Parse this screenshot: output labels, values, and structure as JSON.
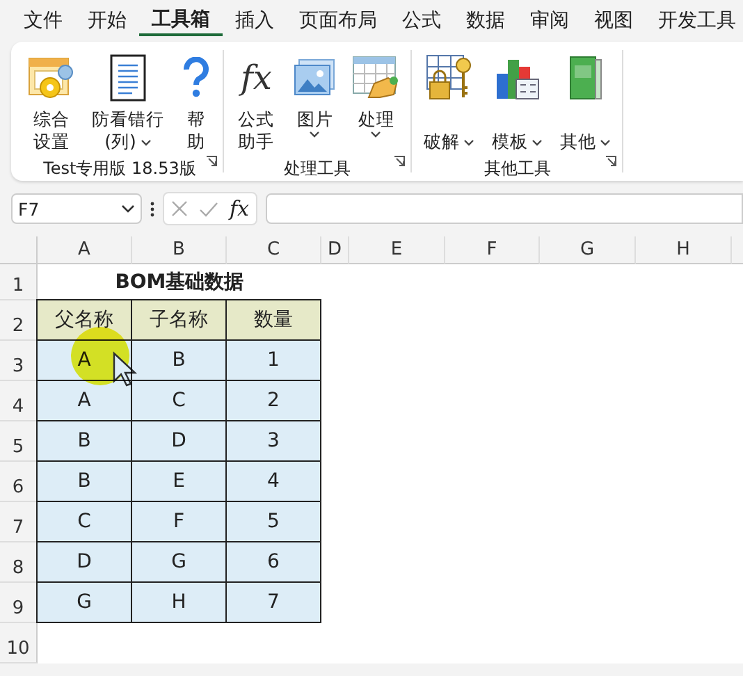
{
  "menu_tabs": [
    {
      "label": "文件",
      "selected": false
    },
    {
      "label": "开始",
      "selected": false
    },
    {
      "label": "工具箱",
      "selected": true
    },
    {
      "label": "插入",
      "selected": false
    },
    {
      "label": "页面布局",
      "selected": false
    },
    {
      "label": "公式",
      "selected": false
    },
    {
      "label": "数据",
      "selected": false
    },
    {
      "label": "审阅",
      "selected": false
    },
    {
      "label": "视图",
      "selected": false
    },
    {
      "label": "开发工具",
      "selected": false
    }
  ],
  "ribbon": {
    "groups": [
      {
        "label": "Test专用版 18.53版",
        "caret_inline": false,
        "buttons": [
          {
            "lines": [
              "综合",
              "设置"
            ],
            "dropdown": false
          },
          {
            "lines": [
              "防看错行",
              "(列)"
            ],
            "dropdown": true
          },
          {
            "lines": [
              "帮",
              "助"
            ],
            "dropdown": false
          }
        ]
      },
      {
        "label": "处理工具",
        "caret_inline": false,
        "buttons": [
          {
            "lines": [
              "公式",
              "助手"
            ],
            "dropdown": false,
            "icon_text": "fx"
          },
          {
            "lines": [
              "图片"
            ],
            "dropdown": true
          },
          {
            "lines": [
              "处理"
            ],
            "dropdown": true
          }
        ]
      },
      {
        "label": "其他工具",
        "caret_inline": true,
        "buttons": [
          {
            "lines": [
              "破解"
            ],
            "dropdown": true
          },
          {
            "lines": [
              "模板"
            ],
            "dropdown": true
          },
          {
            "lines": [
              "其他"
            ],
            "dropdown": true
          }
        ]
      }
    ]
  },
  "formula_bar": {
    "name_box": "F7",
    "function_label": "fx"
  },
  "sheet": {
    "columns": [
      "A",
      "B",
      "C",
      "D",
      "E",
      "F",
      "G",
      "H"
    ],
    "row_numbers": [
      "1",
      "2",
      "3",
      "4",
      "5",
      "6",
      "7",
      "8",
      "9",
      "10"
    ],
    "title": "BOM基础数据",
    "header": [
      "父名称",
      "子名称",
      "数量"
    ],
    "rows": [
      [
        "A",
        "B",
        "1"
      ],
      [
        "A",
        "C",
        "2"
      ],
      [
        "B",
        "D",
        "3"
      ],
      [
        "B",
        "E",
        "4"
      ],
      [
        "C",
        "F",
        "5"
      ],
      [
        "D",
        "G",
        "6"
      ],
      [
        "G",
        "H",
        "7"
      ]
    ]
  }
}
